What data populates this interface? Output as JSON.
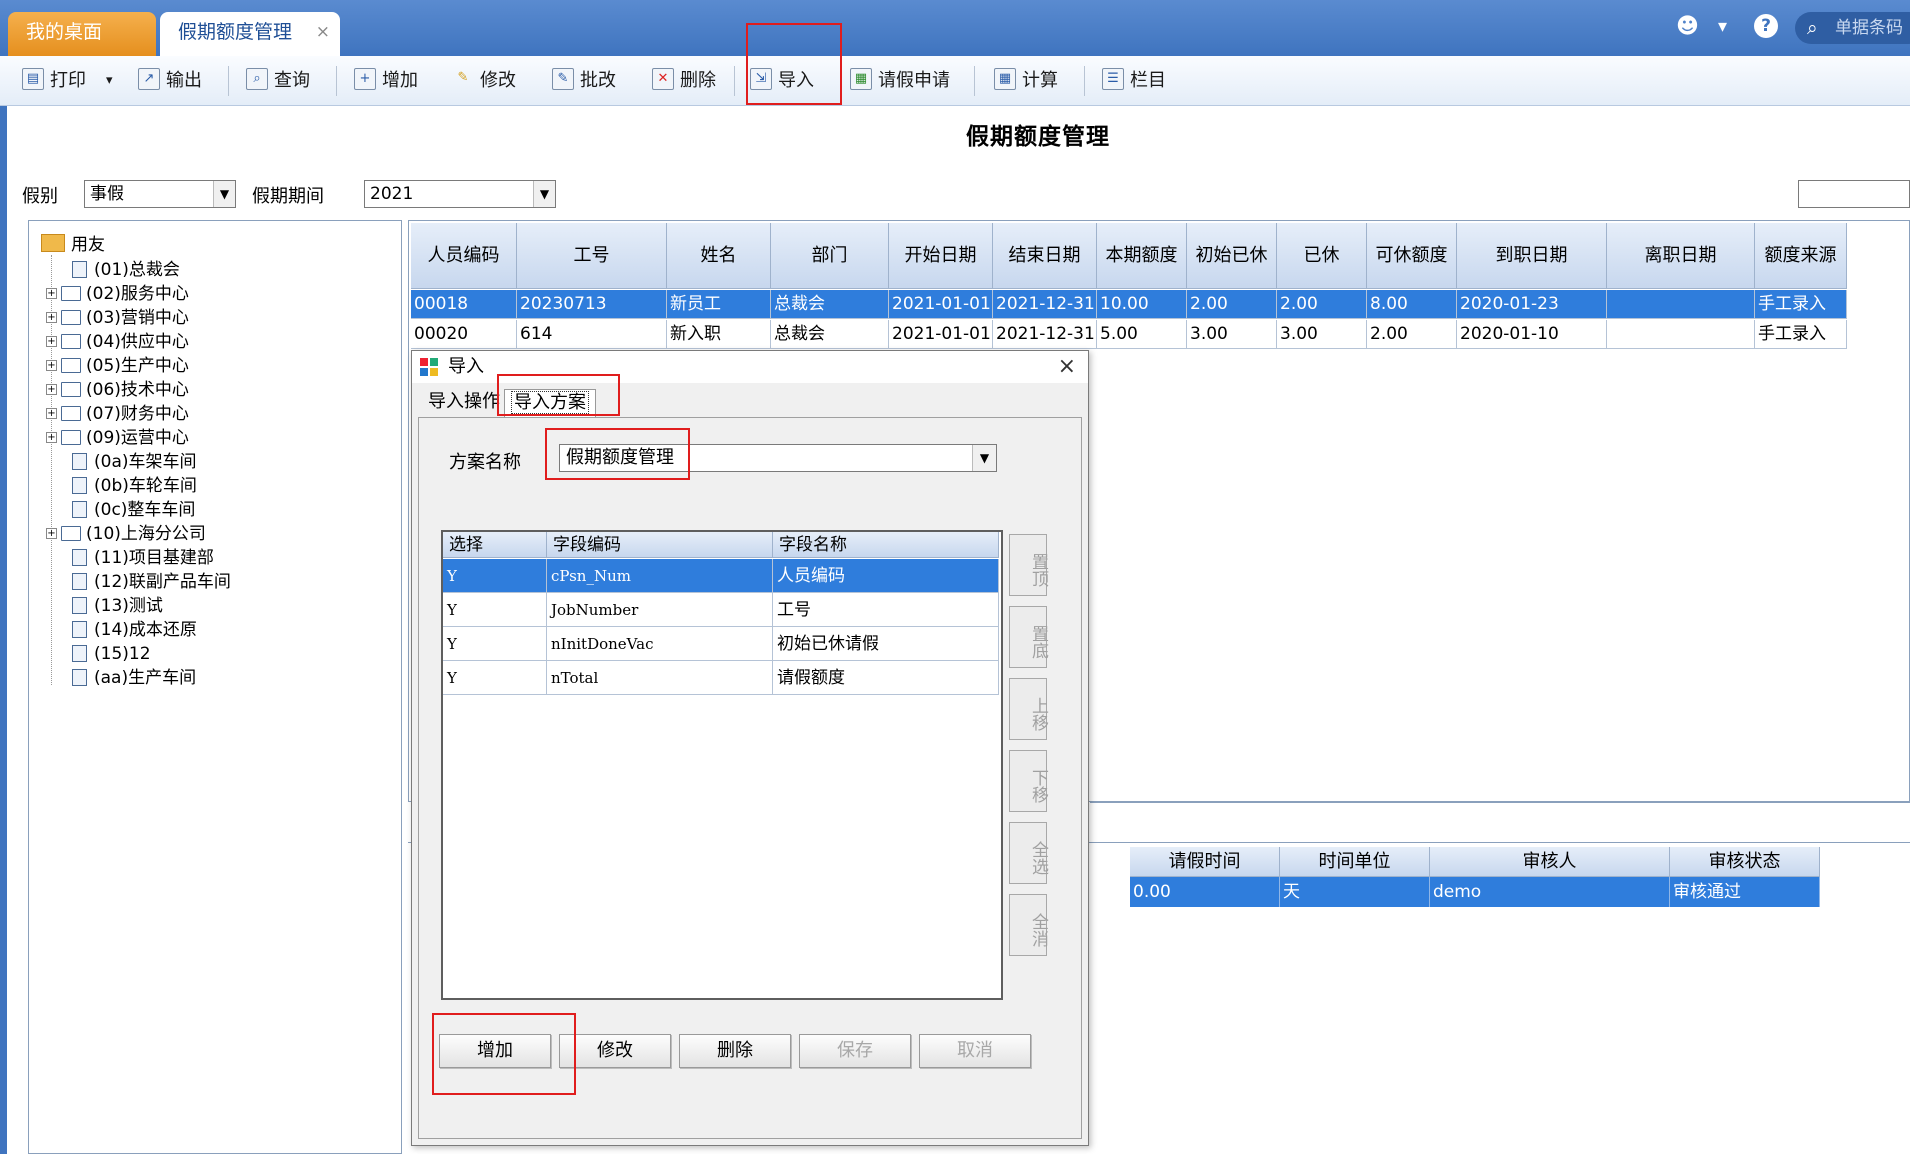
{
  "tabs": {
    "desktop": "我的桌面",
    "current": "假期额度管理",
    "close": "×"
  },
  "header": {
    "search_placeholder": "单据条码",
    "smile_icon": "☻",
    "dropdown_icon": "▾",
    "help_icon": "?"
  },
  "toolbar": {
    "print": "打印",
    "print_menu": "▾",
    "export": "输出",
    "query": "查询",
    "add": "增加",
    "modify": "修改",
    "batch_modify": "批改",
    "delete": "删除",
    "import": "导入",
    "leave_request": "请假申请",
    "calculate": "计算",
    "columns": "栏目"
  },
  "page": {
    "title": "假期额度管理"
  },
  "filters": {
    "type_label": "假别",
    "type_value": "事假",
    "period_label": "假期期间",
    "period_value": "2021"
  },
  "tree": {
    "root": "用友",
    "items": [
      {
        "label": "(01)总裁会",
        "expandable": false
      },
      {
        "label": "(02)服务中心",
        "expandable": true
      },
      {
        "label": "(03)营销中心",
        "expandable": true
      },
      {
        "label": "(04)供应中心",
        "expandable": true
      },
      {
        "label": "(05)生产中心",
        "expandable": true
      },
      {
        "label": "(06)技术中心",
        "expandable": true
      },
      {
        "label": "(07)财务中心",
        "expandable": true
      },
      {
        "label": "(09)运营中心",
        "expandable": true
      },
      {
        "label": "(0a)车架车间",
        "expandable": false
      },
      {
        "label": "(0b)车轮车间",
        "expandable": false
      },
      {
        "label": "(0c)整车车间",
        "expandable": false
      },
      {
        "label": "(10)上海分公司",
        "expandable": true
      },
      {
        "label": "(11)项目基建部",
        "expandable": false
      },
      {
        "label": "(12)联副产品车间",
        "expandable": false
      },
      {
        "label": "(13)测试",
        "expandable": false
      },
      {
        "label": "(14)成本还原",
        "expandable": false
      },
      {
        "label": "(15)12",
        "expandable": false
      },
      {
        "label": "(aa)生产车间",
        "expandable": false
      }
    ]
  },
  "grid": {
    "columns": [
      "人员编码",
      "工号",
      "姓名",
      "部门",
      "开始日期",
      "结束日期",
      "本期额度",
      "初始已休",
      "已休",
      "可休额度",
      "到职日期",
      "离职日期",
      "额度来源"
    ],
    "rows": [
      [
        "00018",
        "20230713",
        "新员工",
        "总裁会",
        "2021-01-01",
        "2021-12-31",
        "10.00",
        "2.00",
        "2.00",
        "8.00",
        "2020-01-23",
        "",
        "手工录入"
      ],
      [
        "00020",
        "614",
        "新入职",
        "总裁会",
        "2021-01-01",
        "2021-12-31",
        "5.00",
        "3.00",
        "3.00",
        "2.00",
        "2020-01-10",
        "",
        "手工录入"
      ]
    ]
  },
  "bottom_grid": {
    "columns": [
      "请假时间",
      "时间单位",
      "审核人",
      "审核状态"
    ],
    "row": [
      "0.00",
      "天",
      "demo",
      "审核通过"
    ]
  },
  "dialog": {
    "title": "导入",
    "close": "×",
    "tab_operation": "导入操作",
    "tab_plan": "导入方案",
    "plan_label": "方案名称",
    "plan_value": "假期额度管理",
    "field_columns": [
      "选择",
      "字段编码",
      "字段名称"
    ],
    "fields": [
      [
        "Y",
        "cPsn_Num",
        "人员编码"
      ],
      [
        "Y",
        "JobNumber",
        "工号"
      ],
      [
        "Y",
        "nInitDoneVac",
        "初始已休请假"
      ],
      [
        "Y",
        "nTotal",
        "请假额度"
      ]
    ],
    "side_buttons": [
      "置顶",
      "置底",
      "上移",
      "下移",
      "全选",
      "全消"
    ],
    "buttons": {
      "add": "增加",
      "modify": "修改",
      "delete": "删除",
      "save": "保存",
      "cancel": "取消"
    }
  },
  "colors": {
    "accent": "#3f74bf",
    "selection": "#2f7ddc",
    "highlight": "#e01d1d",
    "tab_orange": "#e58f1e"
  }
}
